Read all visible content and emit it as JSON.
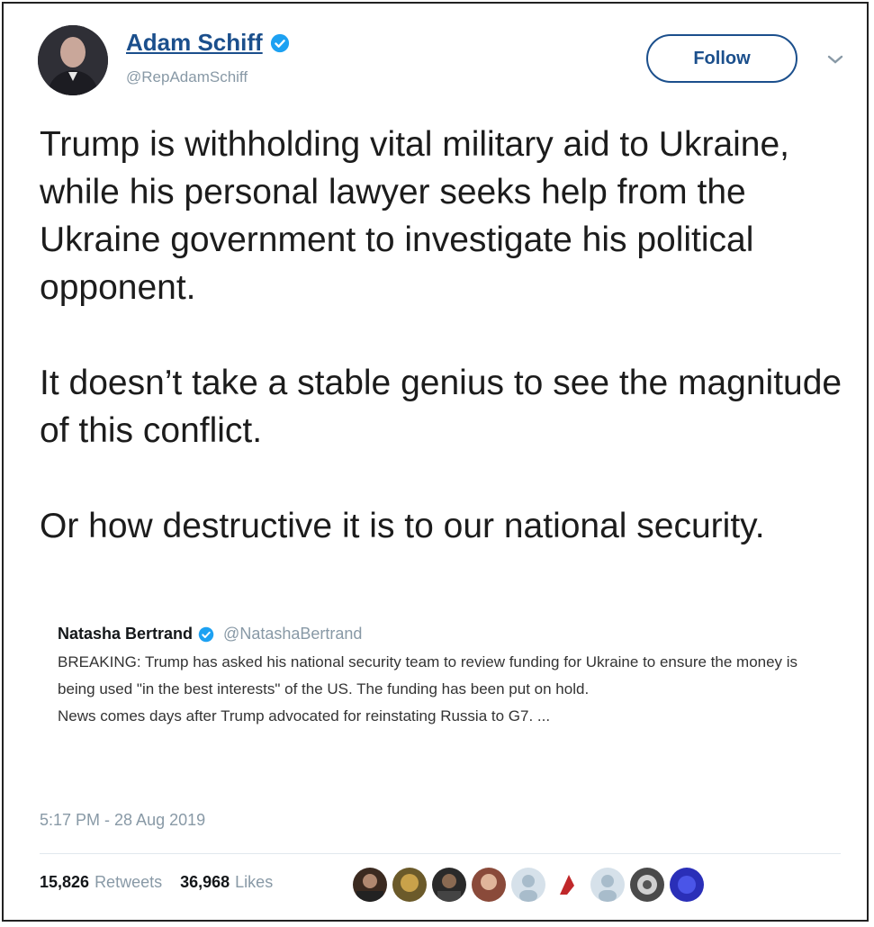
{
  "author": {
    "name": "Adam Schiff",
    "handle": "@RepAdamSchiff"
  },
  "follow_label": "Follow",
  "tweet_paragraphs": [
    "Trump is withholding vital military aid to Ukraine, while his personal lawyer seeks help from the Ukraine government to investigate his political opponent.",
    "It doesn’t take a stable genius to see the magnitude of this conflict.",
    "Or how destructive it is to our national security."
  ],
  "quoted": {
    "name": "Natasha Bertrand",
    "handle": "@NatashaBertrand",
    "text": "BREAKING: Trump has asked his national security team to review funding for Ukraine to ensure the money is being used \"in the best interests\" of the US. The funding has been put on hold.",
    "text2": "News comes days after Trump advocated for reinstating Russia to G7. ..."
  },
  "timestamp": "5:17 PM - 28 Aug 2019",
  "stats": {
    "retweets_count": "15,826",
    "retweets_label": "Retweets",
    "likes_count": "36,968",
    "likes_label": "Likes"
  },
  "colors": {
    "link_blue": "#1b4f8c",
    "verified_blue": "#1da1f2",
    "muted_gray": "#8899a6"
  },
  "icons": [
    "verified-badge-icon",
    "chevron-down-icon"
  ]
}
